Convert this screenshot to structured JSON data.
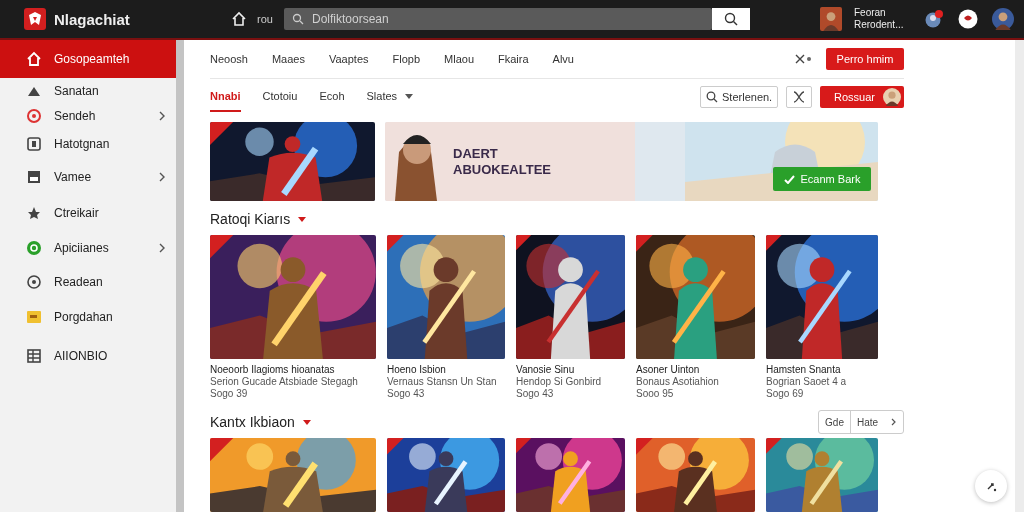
{
  "topbar": {
    "brand": "Nlagachiat",
    "home_label": "rou",
    "search": {
      "placeholder": "Dolfiktoorsean"
    },
    "user": {
      "name": "Feoran",
      "subtitle": "Rerodent..."
    }
  },
  "sidebar": {
    "items": [
      {
        "label": "Gosopeamteh",
        "selected": true,
        "has_submenu": false
      },
      {
        "label": "Sanatan",
        "selected": false,
        "has_submenu": false
      },
      {
        "label": "Sendeh",
        "selected": false,
        "has_submenu": true
      },
      {
        "label": "Hatotgnan",
        "selected": false,
        "has_submenu": false
      },
      {
        "label": "Vamee",
        "selected": false,
        "has_submenu": true
      },
      {
        "label": "Ctreikair",
        "selected": false,
        "has_submenu": false
      },
      {
        "label": "Apiciianes",
        "selected": false,
        "has_submenu": true
      },
      {
        "label": "Readean",
        "selected": false,
        "has_submenu": false
      },
      {
        "label": "Porgdahan",
        "selected": false,
        "has_submenu": false
      },
      {
        "label": "AIIONBIO",
        "selected": false,
        "has_submenu": false
      }
    ]
  },
  "nav": {
    "links": [
      "Neoosh",
      "Maaes",
      "Vaaptes",
      "Flopb",
      "Mlaou",
      "Fkaira",
      "Alvu"
    ],
    "action": "Perro hmim"
  },
  "tabs": [
    {
      "label": "Nnabi",
      "selected": true
    },
    {
      "label": "Ctotoiu",
      "selected": false
    },
    {
      "label": "Ecoh",
      "selected": false
    },
    {
      "label": "Slates",
      "selected": false
    }
  ],
  "filter": {
    "search_placeholder": "Sterlenen.",
    "action": "Rossuar"
  },
  "banner": {
    "headline": [
      "DAERT",
      "ABUOKEALTEE"
    ],
    "button": "Ecanm Bark"
  },
  "sections": [
    {
      "title": "Ratoqi Kiarıs",
      "cards": [
        {
          "title": "Noeoorb Ilagioms hioanatas",
          "subtitle": "Serion Gucade Atsbiade Stegagh",
          "meta": "Sogo 39"
        },
        {
          "title": "Hoeno Isbion",
          "subtitle": "Vernaus Stansn Un Stan",
          "meta": "Sogo 43"
        },
        {
          "title": "Vanosie Sinu",
          "subtitle": "Hendop Si Gonbird",
          "meta": "Sogo 43"
        },
        {
          "title": "Asoner Uinton",
          "subtitle": "Bonaus Asotiahion",
          "meta": "Sooo 95"
        },
        {
          "title": "Hamsten Snanta",
          "subtitle": "Bogrian Saoet 4 a",
          "meta": "Sogo 69"
        }
      ]
    },
    {
      "title": "Kantx Ikbiaon",
      "sort": [
        "Gde",
        "Hate"
      ]
    }
  ]
}
